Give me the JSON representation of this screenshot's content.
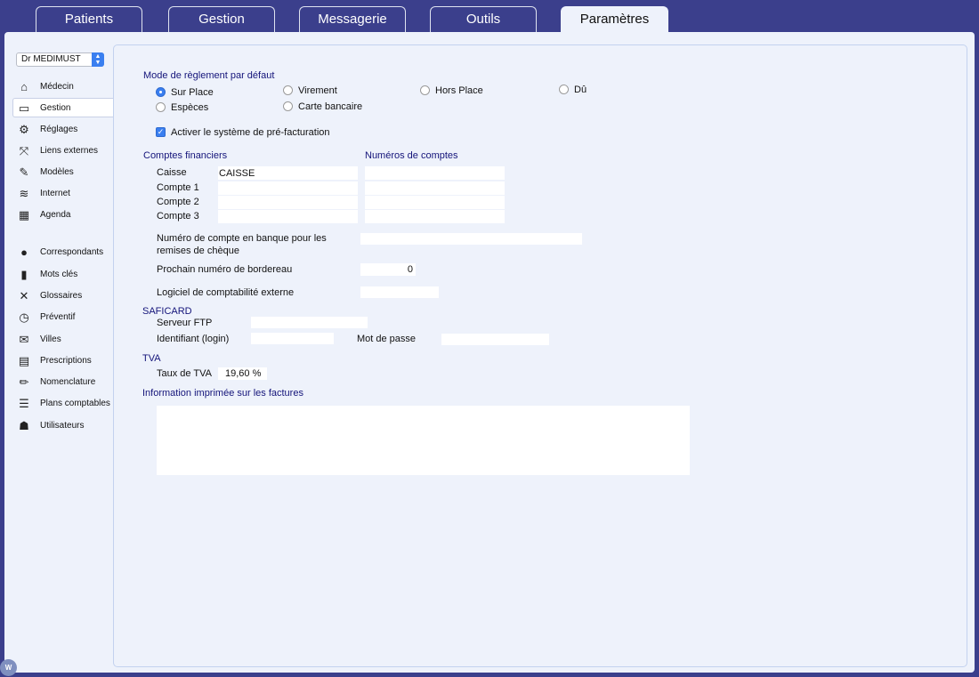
{
  "tabs": [
    "Patients",
    "Gestion",
    "Messagerie",
    "Outils",
    "Paramètres"
  ],
  "sidebar": {
    "doctor": "Dr MEDIMUST",
    "items": [
      {
        "label": "Médecin",
        "icon": "house-icon",
        "glyph": "⌂"
      },
      {
        "label": "Gestion",
        "icon": "inbox-tray-icon",
        "glyph": "▭"
      },
      {
        "label": "Réglages",
        "icon": "gear-icon",
        "glyph": "⚙"
      },
      {
        "label": "Liens externes",
        "icon": "expand-arrows-icon",
        "glyph": "⤧"
      },
      {
        "label": "Modèles",
        "icon": "edit-document-icon",
        "glyph": "✎"
      },
      {
        "label": "Internet",
        "icon": "wifi-icon",
        "glyph": "≋"
      },
      {
        "label": "Agenda",
        "icon": "calendar-icon",
        "glyph": "▦"
      },
      {
        "label": "Correspondants",
        "icon": "person-icon",
        "glyph": "●"
      },
      {
        "label": "Mots clés",
        "icon": "bar-chart-icon",
        "glyph": "▮"
      },
      {
        "label": "Glossaires",
        "icon": "tools-icon",
        "glyph": "✕"
      },
      {
        "label": "Préventif",
        "icon": "clock-icon",
        "glyph": "◷"
      },
      {
        "label": "Villes",
        "icon": "envelope-icon",
        "glyph": "✉"
      },
      {
        "label": "Prescriptions",
        "icon": "list-document-icon",
        "glyph": "▤"
      },
      {
        "label": "Nomenclature",
        "icon": "pencil-icon",
        "glyph": "✏"
      },
      {
        "label": "Plans comptables",
        "icon": "list-icon",
        "glyph": "☰"
      },
      {
        "label": "Utilisateurs",
        "icon": "users-icon",
        "glyph": "☗"
      }
    ]
  },
  "payment": {
    "title": "Mode de règlement par défaut",
    "options": [
      "Sur Place",
      "Virement",
      "Hors Place",
      "Dû",
      "Espèces",
      "Carte bancaire"
    ],
    "selected": "Sur Place",
    "prebilling_label": "Activer le système de pré-facturation",
    "prebilling_checked": true
  },
  "accounts": {
    "title": "Comptes financiers",
    "numbers_title": "Numéros de comptes",
    "rows": [
      {
        "label": "Caisse",
        "name": "CAISSE",
        "number": ""
      },
      {
        "label": "Compte 1",
        "name": "",
        "number": ""
      },
      {
        "label": "Compte 2",
        "name": "",
        "number": ""
      },
      {
        "label": "Compte 3",
        "name": "",
        "number": ""
      }
    ]
  },
  "bank": {
    "label_line1": "Numéro de compte en banque pour les",
    "label_line2": "remises de chèque",
    "value": "",
    "next_slip_label": "Prochain numéro de bordereau",
    "next_slip_value": "0",
    "software_label": "Logiciel de comptabilité externe",
    "software_value": ""
  },
  "saficard": {
    "title": "SAFICARD",
    "ftp_label": "Serveur FTP",
    "ftp_value": "",
    "login_label": "Identifiant (login)",
    "login_value": "",
    "password_label": "Mot de passe",
    "password_value": ""
  },
  "tva": {
    "title": "TVA",
    "rate_label": "Taux de TVA",
    "rate_value": "19,60 %"
  },
  "invoice": {
    "title": "Information imprimée sur les factures",
    "value": ""
  },
  "badge": "W"
}
